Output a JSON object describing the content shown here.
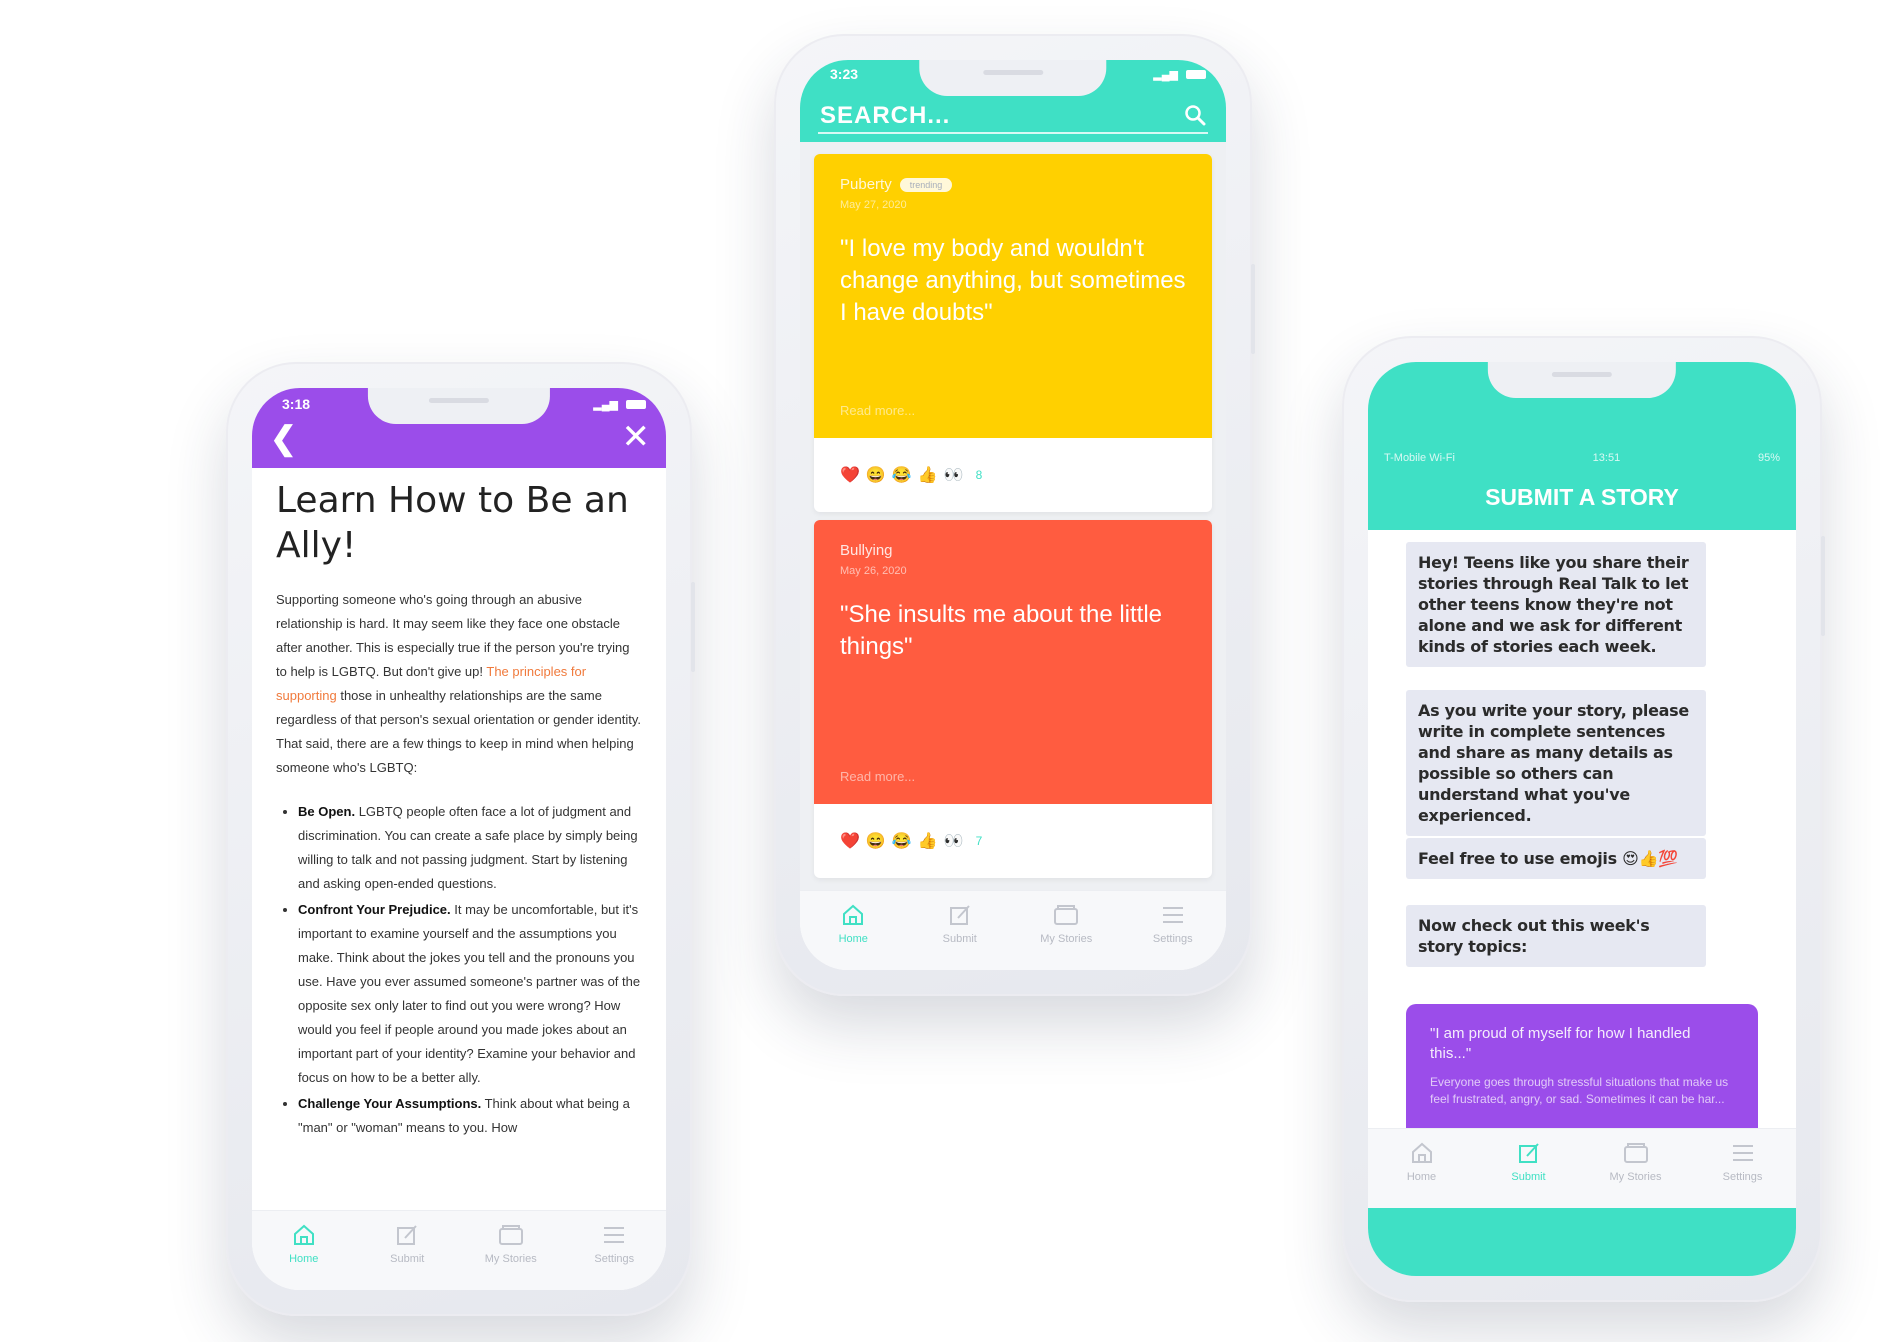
{
  "phone_left": {
    "status_time": "3:18",
    "header_color": "#9b4dea",
    "back_icon": "chevron-left-icon",
    "close_icon": "close-icon",
    "title": "Learn How to Be an Ally!",
    "intro_before_link": "Supporting someone who's going through an abusive relationship is hard. It may seem like they face one obstacle after another. This is especially true if the person you're trying to help is LGBTQ. But don't give up! ",
    "intro_link": "The principles for supporting",
    "intro_after_link": " those in unhealthy relationships are the same regardless of that person's sexual orientation or gender identity. That said, there are a few things to keep in mind when helping someone who's LGBTQ:",
    "bullets": [
      {
        "bold": "Be Open.",
        "text": " LGBTQ people often face a lot of judgment and discrimination. You can create a safe place by simply being willing to talk and not passing judgment. Start by listening and asking open-ended questions."
      },
      {
        "bold": "Confront Your Prejudice.",
        "text": " It may be uncomfortable, but it's important to examine yourself and the assumptions you make. Think about the jokes you tell and the pronouns you use. Have you ever assumed someone's partner was of the opposite sex only later to find out you were wrong? How would you feel if people around you made jokes about an important part of your identity? Examine your behavior and focus on how to be a better ally."
      },
      {
        "bold": "Challenge Your Assumptions.",
        "text": " Think about what being a \"man\" or \"woman\" means to you. How"
      }
    ],
    "tabs": [
      {
        "label": "Home",
        "icon": "home-icon",
        "active": true
      },
      {
        "label": "Submit",
        "icon": "edit-icon",
        "active": false
      },
      {
        "label": "My Stories",
        "icon": "folder-icon",
        "active": false
      },
      {
        "label": "Settings",
        "icon": "menu-icon",
        "active": false
      }
    ]
  },
  "phone_center": {
    "status_time": "3:23",
    "header_color": "#3fe0c5",
    "search_placeholder": "SEARCH...",
    "search_icon": "search-icon",
    "stories": [
      {
        "category": "Puberty",
        "badge": "trending",
        "date": "May 27, 2020",
        "quote": "\"I love my body and wouldn't change anything, but sometimes I have doubts\"",
        "read_more": "Read more...",
        "color": "#ffd000",
        "reactions": [
          "❤️",
          "😄",
          "😂",
          "👍",
          "👀"
        ],
        "reaction_count": "8"
      },
      {
        "category": "Bullying",
        "date": "May 26, 2020",
        "quote": "\"She insults me about the little things\"",
        "read_more": "Read more...",
        "color": "#ff5c40",
        "reactions": [
          "❤️",
          "😄",
          "😂",
          "👍",
          "👀"
        ],
        "reaction_count": "7"
      }
    ],
    "tabs": [
      {
        "label": "Home",
        "icon": "home-icon",
        "active": true
      },
      {
        "label": "Submit",
        "icon": "edit-icon",
        "active": false
      },
      {
        "label": "My Stories",
        "icon": "folder-icon",
        "active": false
      },
      {
        "label": "Settings",
        "icon": "menu-icon",
        "active": false
      }
    ]
  },
  "phone_right": {
    "status_carrier": "T-Mobile Wi-Fi",
    "status_time": "13:51",
    "status_battery": "95%",
    "header_color": "#3fe0c5",
    "title": "SUBMIT A STORY",
    "messages": [
      "Hey! Teens like you share their stories through Real Talk to let other teens know they're not alone and we ask for different kinds of stories each week.",
      "As you write your story, please write in complete sentences and share as many details as possible so others can understand what you've experienced.",
      "Feel free to use emojis 😍👍💯",
      "Now check out this week's story topics:"
    ],
    "topic_card": {
      "quote": "\"I am proud of myself for how I handled this...\"",
      "description": "Everyone goes through stressful situations that make us feel frustrated, angry, or sad. Sometimes it can be har...",
      "color": "#9b4dea"
    },
    "tabs": [
      {
        "label": "Home",
        "icon": "home-icon",
        "active": false
      },
      {
        "label": "Submit",
        "icon": "edit-icon",
        "active": true
      },
      {
        "label": "My Stories",
        "icon": "folder-icon",
        "active": false
      },
      {
        "label": "Settings",
        "icon": "menu-icon",
        "active": false
      }
    ]
  }
}
